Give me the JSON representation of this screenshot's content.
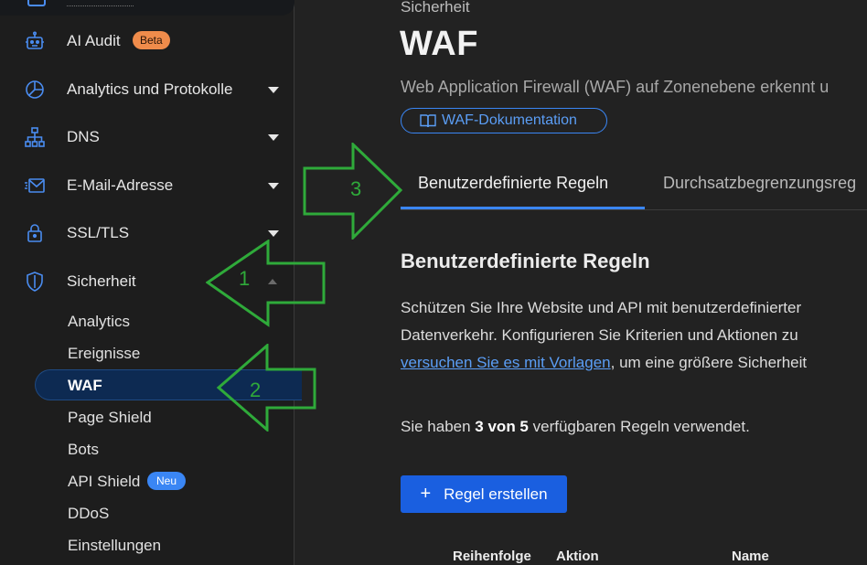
{
  "sidebar": {
    "items": [
      {
        "label": "AI Audit",
        "icon": "bot-icon",
        "badge": "Beta"
      },
      {
        "label": "Analytics und Protokolle",
        "icon": "pie-chart-icon"
      },
      {
        "label": "DNS",
        "icon": "network-icon"
      },
      {
        "label": "E-Mail-Adresse",
        "icon": "mail-icon"
      },
      {
        "label": "SSL/TLS",
        "icon": "lock-icon"
      },
      {
        "label": "Sicherheit",
        "icon": "shield-icon"
      }
    ],
    "security_sub": [
      {
        "label": "Analytics"
      },
      {
        "label": "Ereignisse"
      },
      {
        "label": "WAF"
      },
      {
        "label": "Page Shield"
      },
      {
        "label": "Bots"
      },
      {
        "label": "API Shield",
        "badge": "Neu"
      },
      {
        "label": "DDoS"
      },
      {
        "label": "Einstellungen"
      }
    ]
  },
  "main": {
    "breadcrumb": "Sicherheit",
    "title": "WAF",
    "subtitle": "Web Application Firewall (WAF) auf Zonenebene erkennt u",
    "doc_button": "WAF-Dokumentation",
    "tabs": [
      {
        "label": "Benutzerdefinierte Regeln"
      },
      {
        "label": "Durchsatzbegrenzungsreg"
      }
    ],
    "section_title": "Benutzerdefinierte Regeln",
    "para_line1": "Schützen Sie Ihre Website und API mit benutzerdefinierter",
    "para_line2": "Datenverkehr. Konfigurieren Sie Kriterien und Aktionen zu",
    "para_link": "versuchen Sie es mit Vorlagen",
    "para_line3_rest": ", um eine größere Sicherheit",
    "usage_prefix": "Sie haben ",
    "usage_bold": "3 von 5",
    "usage_suffix": " verfügbaren Regeln verwendet.",
    "create_button": "Regel erstellen",
    "table_headers": [
      "Reihenfolge",
      "Aktion",
      "Name"
    ]
  },
  "annotations": [
    "1",
    "2",
    "3"
  ],
  "colors": {
    "accent": "#3a86f4",
    "sidebar_bg": "#1d1d1d",
    "main_bg": "#222222",
    "active_bg": "#0d2a52",
    "beta_badge": "#f08c4b",
    "annotation": "#2faa3a"
  }
}
